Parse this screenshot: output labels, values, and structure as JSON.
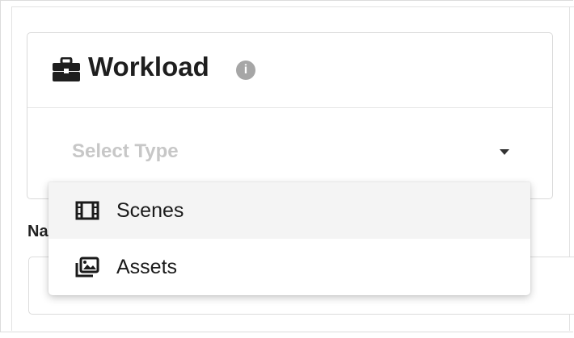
{
  "card": {
    "title": "Workload",
    "title_icon": "briefcase-icon",
    "info_icon_glyph": "i"
  },
  "select": {
    "placeholder": "Select Type",
    "caret_icon": "caret-down-icon"
  },
  "dropdown": {
    "items": [
      {
        "label": "Scenes",
        "icon": "film-icon",
        "highlighted": true
      },
      {
        "label": "Assets",
        "icon": "images-icon",
        "highlighted": false
      }
    ]
  },
  "form": {
    "name_label_visible": "Na"
  },
  "colors": {
    "title": "#1e1e1e",
    "placeholder": "#c7c7c7",
    "info_icon_bg": "#a6a6a6",
    "highlight_bg": "#f4f4f4",
    "border": "#d9d9d9"
  }
}
